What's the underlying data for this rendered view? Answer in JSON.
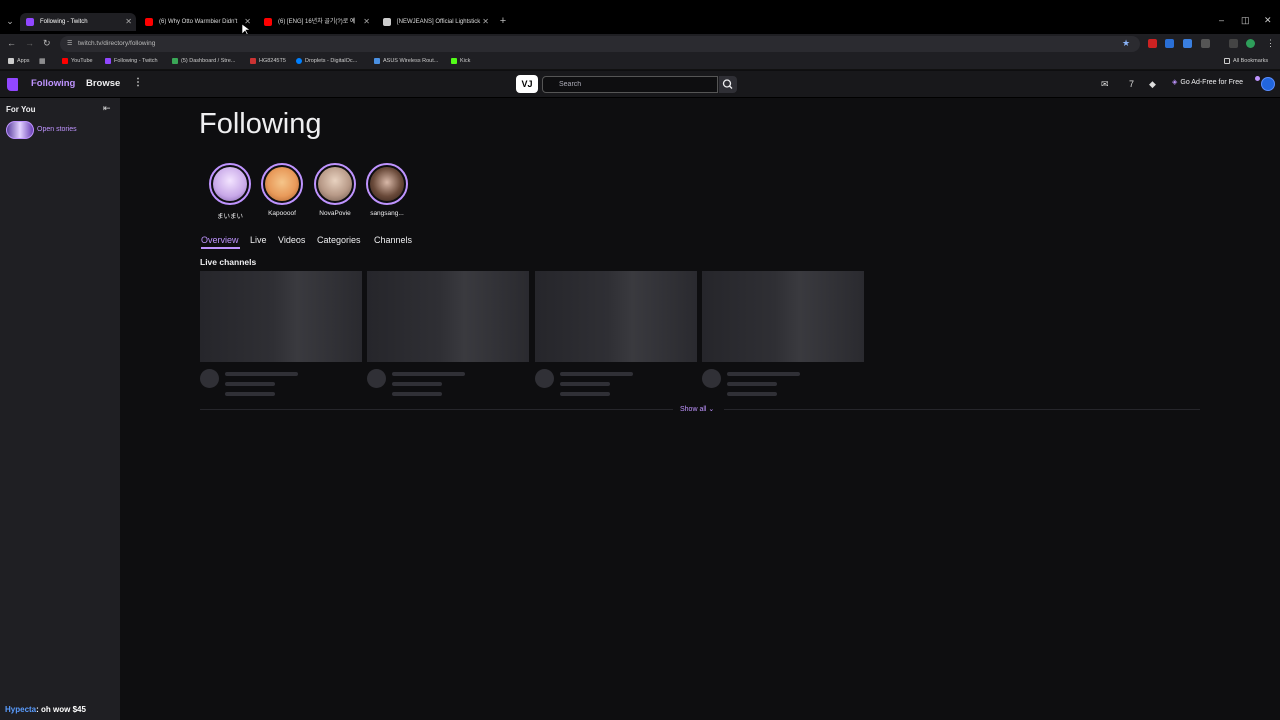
{
  "browser": {
    "tabs": [
      {
        "title": "Following - Twitch",
        "color": "#9147ff"
      },
      {
        "title": "(6) Why Otto Warmbier Didn't",
        "color": "#ff0000"
      },
      {
        "title": "(6) [ENG] 16년차 골기(?)로 예",
        "color": "#ff0000"
      },
      {
        "title": "[NEWJEANS] Official Lightstick",
        "color": "#cccccc"
      }
    ],
    "new_tab": "+",
    "url": "twitch.tv/directory/following",
    "bookmarks": [
      {
        "label": "Apps",
        "color": "#cccccc"
      },
      {
        "label": "YouTube",
        "color": "#ff0000"
      },
      {
        "label": "Following - Twitch",
        "color": "#9147ff"
      },
      {
        "label": "(5) Dashboard / Stre...",
        "color": "#3aa757"
      },
      {
        "label": "HG8245T5",
        "color": "#cc3333"
      },
      {
        "label": "Droplets - DigitalOc...",
        "color": "#0080ff"
      },
      {
        "label": "ASUS Wireless Rout...",
        "color": "#4a90e2"
      },
      {
        "label": "Kick",
        "color": "#53fc18"
      }
    ],
    "all_bookmarks": "All Bookmarks"
  },
  "nav": {
    "following": "Following",
    "browse": "Browse",
    "search_placeholder": "Search",
    "vj_label": "VJ",
    "ad_free": "Go Ad-Free for Free"
  },
  "sidebar": {
    "for_you": "For You",
    "open_stories": "Open stories"
  },
  "chat": {
    "user": "Hypecta",
    "message": ": oh wow $45"
  },
  "main": {
    "title": "Following",
    "stories": [
      {
        "name": "まいまい",
        "color": "#c8a8e8"
      },
      {
        "name": "Kapoooof",
        "color": "#e89a5a"
      },
      {
        "name": "NovaPovie",
        "color": "#b89a88"
      },
      {
        "name": "sangsang...",
        "color": "#6a4a3a"
      }
    ],
    "tabs": [
      "Overview",
      "Live",
      "Videos",
      "Categories",
      "Channels"
    ],
    "section_title": "Live channels",
    "show_all": "Show all"
  }
}
